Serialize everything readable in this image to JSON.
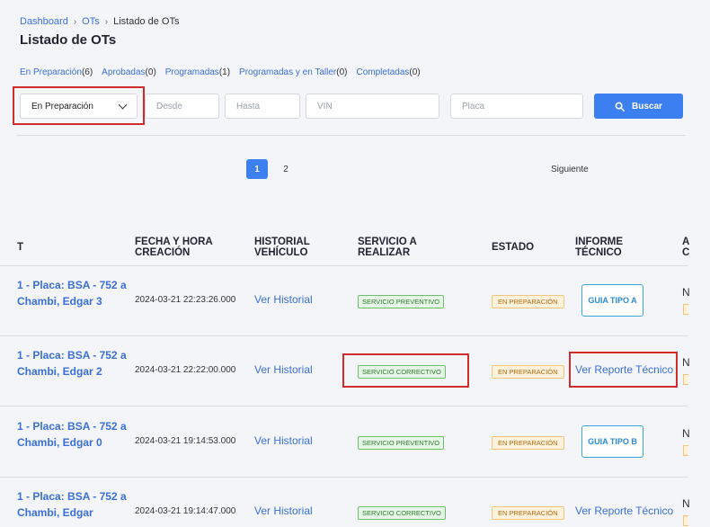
{
  "breadcrumb": {
    "item1": "Dashboard",
    "item2": "OTs",
    "current": "Listado de OTs"
  },
  "page_title": "Listado de OTs",
  "status_tabs": [
    {
      "label": "En Preparación",
      "count": "(6)"
    },
    {
      "label": "Aprobadas",
      "count": "(0)"
    },
    {
      "label": "Programadas",
      "count": "(1)"
    },
    {
      "label": "Programadas y en Taller",
      "count": "(0)"
    },
    {
      "label": "Completadas",
      "count": "(0)"
    }
  ],
  "filters": {
    "status_selected": "En Preparación",
    "desde_placeholder": "Desde",
    "hasta_placeholder": "Hasta",
    "vin_placeholder": "VIN",
    "placa_placeholder": "Placa",
    "search_label": "Buscar"
  },
  "pagination": {
    "pages": [
      "1",
      "2"
    ],
    "next_label": "Siguiente"
  },
  "table": {
    "headers": {
      "ot": "T",
      "fecha": "FECHA Y HORA CREACIÓN",
      "historial": "HISTORIAL VEHÍCULO",
      "servicio": "SERVICIO A REALIZAR",
      "estado": "ESTADO",
      "informe": "INFORME TÉCNICO",
      "cut": "A C"
    },
    "rows": [
      {
        "ot": "1 - Placa: BSA - 752 a Chambi, Edgar 3",
        "fecha": "2024-03-21 22:23:26.000",
        "historial": "Ver Historial",
        "servicio": "SERVICIO PREVENTIVO",
        "estado": "EN PREPARACIÓN",
        "informe_type": "guide",
        "informe": "GUIA TIPO A",
        "cut": "N"
      },
      {
        "ot": "1 - Placa: BSA - 752 a Chambi, Edgar 2",
        "fecha": "2024-03-21 22:22:00.000",
        "historial": "Ver Historial",
        "servicio": "SERVICIO CORRECTIVO",
        "estado": "EN PREPARACIÓN",
        "informe_type": "link",
        "informe": "Ver Reporte Técnico",
        "cut": "N"
      },
      {
        "ot": "1 - Placa: BSA - 752 a Chambi, Edgar 0",
        "fecha": "2024-03-21 19:14:53.000",
        "historial": "Ver Historial",
        "servicio": "SERVICIO PREVENTIVO",
        "estado": "EN PREPARACIÓN",
        "informe_type": "guide",
        "informe": "GUIA TIPO B",
        "cut": "N"
      },
      {
        "ot": "1 - Placa: BSA - 752 a Chambi, Edgar",
        "fecha": "2024-03-21 19:14:47.000",
        "historial": "Ver Historial",
        "servicio": "SERVICIO CORRECTIVO",
        "estado": "EN PREPARACIÓN",
        "informe_type": "link",
        "informe": "Ver Reporte Técnico",
        "cut": "N"
      }
    ]
  },
  "colors": {
    "accent": "#3b7ff0",
    "link": "#3a6fd8",
    "highlight": "#d22b2b"
  }
}
